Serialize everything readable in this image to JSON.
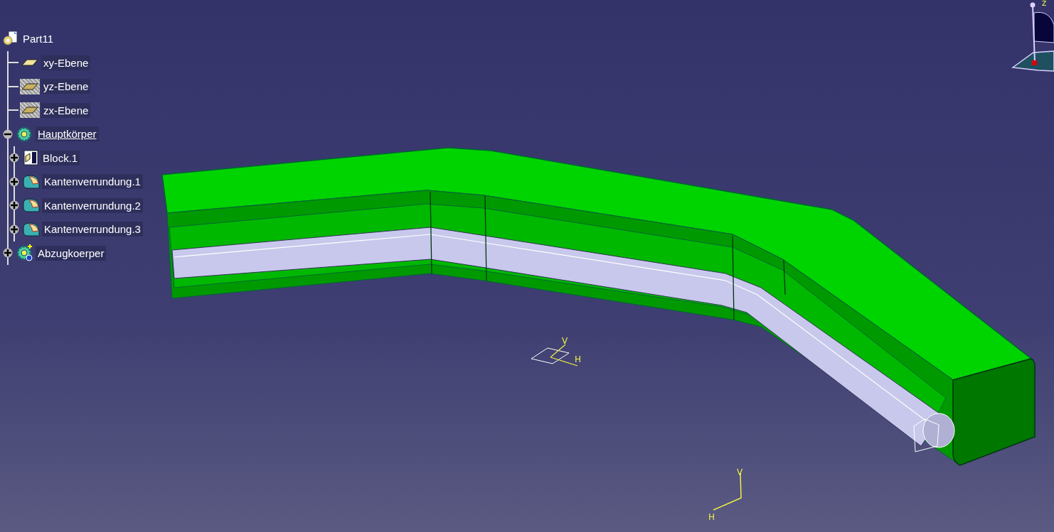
{
  "tree": {
    "label": "Part11",
    "kind": "part",
    "children": [
      {
        "label": "xy-Ebene",
        "kind": "plane",
        "hidden": false
      },
      {
        "label": "yz-Ebene",
        "kind": "plane",
        "hidden": true
      },
      {
        "label": "zx-Ebene",
        "kind": "plane",
        "hidden": true
      },
      {
        "label": "Hauptkörper",
        "kind": "body",
        "expanded": true,
        "in_work": true,
        "children": [
          {
            "label": "Block.1",
            "kind": "pad",
            "expanded": false
          },
          {
            "label": "Kantenverrundung.1",
            "kind": "fillet",
            "expanded": false
          },
          {
            "label": "Kantenverrundung.2",
            "kind": "fillet",
            "expanded": false
          },
          {
            "label": "Kantenverrundung.3",
            "kind": "fillet",
            "expanded": false
          }
        ]
      },
      {
        "label": "Abzugkoerper",
        "kind": "added_body",
        "expanded": false,
        "in_work": false
      }
    ]
  },
  "compass": {
    "axis_label": "z"
  },
  "sketch_axes": [
    {
      "v_label": "V",
      "h_label": "H"
    },
    {
      "v_label": "V",
      "h_label": "H"
    }
  ]
}
